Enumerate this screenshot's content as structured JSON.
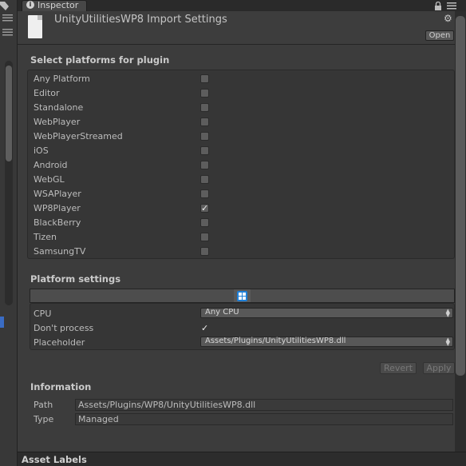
{
  "tab": {
    "label": "Inspector"
  },
  "header": {
    "title": "UnityUtilitiesWP8 Import Settings",
    "open_label": "Open"
  },
  "platforms": {
    "title": "Select platforms for plugin",
    "items": [
      {
        "label": "Any Platform",
        "checked": false
      },
      {
        "label": "Editor",
        "checked": false
      },
      {
        "label": "Standalone",
        "checked": false
      },
      {
        "label": "WebPlayer",
        "checked": false
      },
      {
        "label": "WebPlayerStreamed",
        "checked": false
      },
      {
        "label": "iOS",
        "checked": false
      },
      {
        "label": "Android",
        "checked": false
      },
      {
        "label": "WebGL",
        "checked": false
      },
      {
        "label": "WSAPlayer",
        "checked": false
      },
      {
        "label": "WP8Player",
        "checked": true
      },
      {
        "label": "BlackBerry",
        "checked": false
      },
      {
        "label": "Tizen",
        "checked": false
      },
      {
        "label": "SamsungTV",
        "checked": false
      }
    ]
  },
  "platform_settings": {
    "title": "Platform settings",
    "cpu_label": "CPU",
    "cpu_value": "Any CPU",
    "dont_process_label": "Don't process",
    "dont_process_checked": true,
    "placeholder_label": "Placeholder",
    "placeholder_value": "Assets/Plugins/UnityUtilitiesWP8.dll"
  },
  "actions": {
    "revert_label": "Revert",
    "apply_label": "Apply"
  },
  "information": {
    "title": "Information",
    "path_label": "Path",
    "path_value": "Assets/Plugins/WP8/UnityUtilitiesWP8.dll",
    "type_label": "Type",
    "type_value": "Managed"
  },
  "asset_labels": {
    "title": "Asset Labels"
  },
  "colors": {
    "selection_accent": "#3a6cc4",
    "windows_icon": "#1e7fd7"
  }
}
